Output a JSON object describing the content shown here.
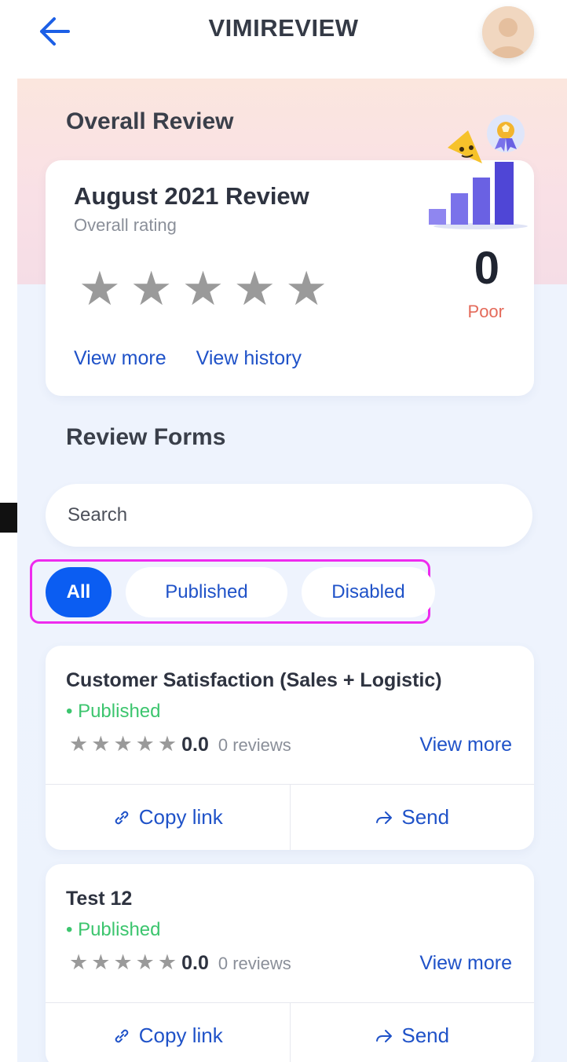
{
  "header": {
    "title": "VIMIREVIEW",
    "back_icon": "arrow-left-icon",
    "avatar_icon": "user-avatar"
  },
  "overall": {
    "section_title": "Overall Review",
    "card_title": "August 2021 Review",
    "subtitle": "Overall rating",
    "rating_stars": 0,
    "score": "0",
    "score_label": "Poor",
    "view_more": "View more",
    "view_history": "View history"
  },
  "review_forms": {
    "section_title": "Review Forms",
    "search_placeholder": "Search",
    "filters": [
      {
        "label": "All",
        "active": true
      },
      {
        "label": "Published",
        "active": false
      },
      {
        "label": "Disabled",
        "active": false
      }
    ],
    "forms": [
      {
        "title": "Customer Satisfaction (Sales + Logistic)",
        "status": "• Published",
        "score": "0.0",
        "reviews": "0 reviews",
        "view_more": "View more",
        "copy_link": "Copy link",
        "send": "Send"
      },
      {
        "title": "Test 12",
        "status": "• Published",
        "score": "0.0",
        "reviews": "0 reviews",
        "view_more": "View more",
        "copy_link": "Copy link",
        "send": "Send"
      }
    ]
  },
  "colors": {
    "accent": "#0b5df2",
    "link": "#1f52c8",
    "published": "#3cc56e",
    "poor": "#e46a5a",
    "highlight": "#ee2bee"
  }
}
